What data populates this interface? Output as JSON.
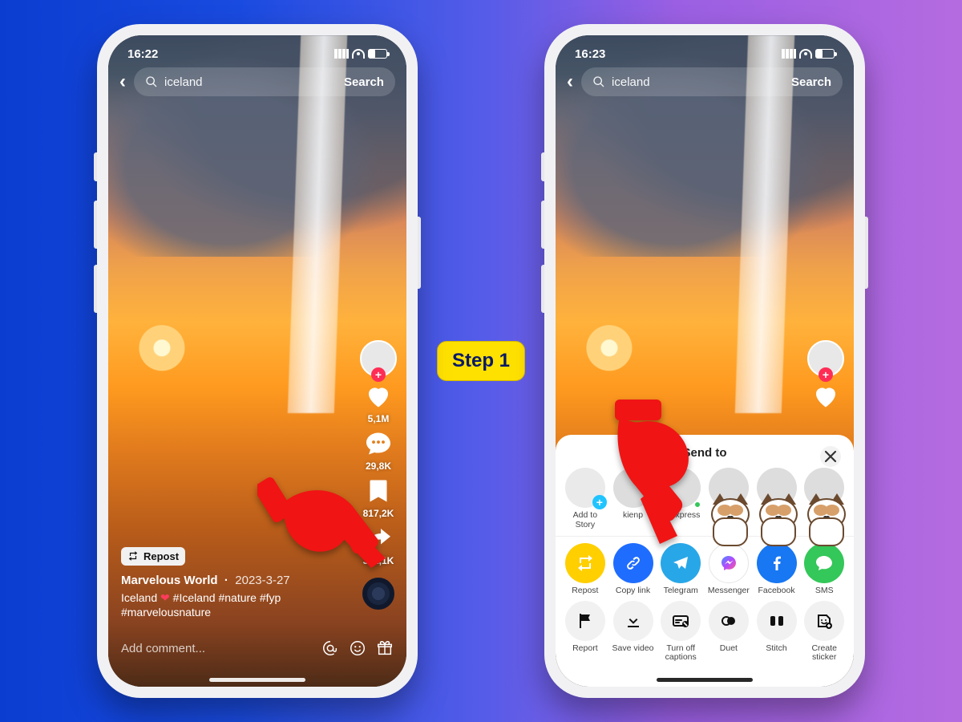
{
  "step_label": "Step 1",
  "phone1": {
    "status_time": "16:22",
    "search_query": "iceland",
    "search_button": "Search",
    "rail": {
      "likes": "5,1M",
      "comments": "29,8K",
      "saves": "817,2K",
      "shares": "392,1K"
    },
    "repost_label": "Repost",
    "username": "Marvelous World",
    "date": "2023-3-27",
    "caption_prefix": "Iceland ",
    "caption_tags": "#Iceland #nature #fyp #marvelousnature",
    "comment_placeholder": "Add comment..."
  },
  "phone2": {
    "status_time": "16:23",
    "search_query": "iceland",
    "search_button": "Search",
    "sheet": {
      "title": "Send to",
      "contacts": {
        "add_story": "Add to Story",
        "c1": "kienp",
        "c2": "fptexpress"
      },
      "share": {
        "repost": "Repost",
        "copylink": "Copy link",
        "telegram": "Telegram",
        "messenger": "Messenger",
        "facebook": "Facebook",
        "sms": "SMS"
      },
      "actions": {
        "report": "Report",
        "save": "Save video",
        "captions": "Turn off captions",
        "duet": "Duet",
        "stitch": "Stitch",
        "sticker": "Create sticker"
      }
    }
  }
}
